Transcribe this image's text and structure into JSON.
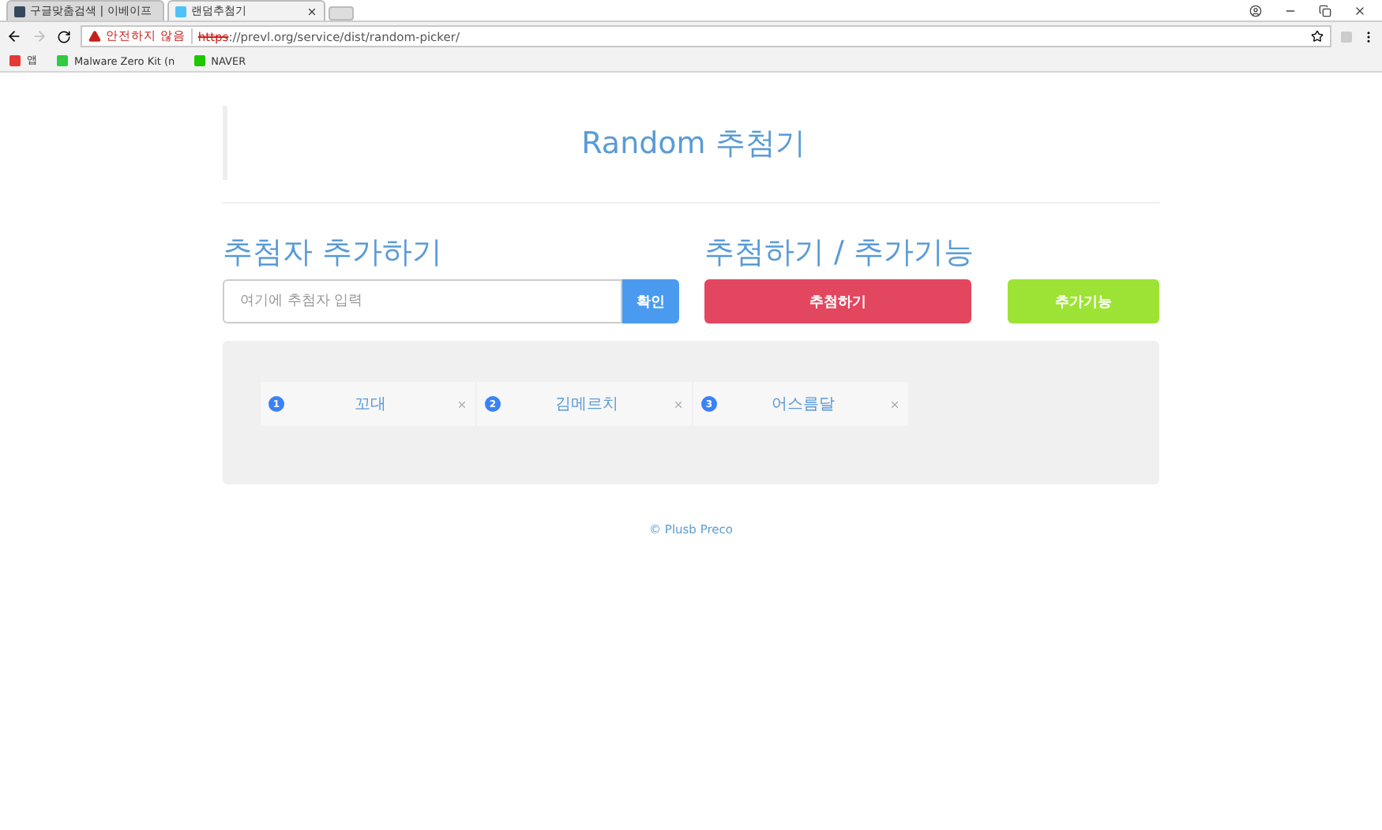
{
  "browser": {
    "tabs": [
      {
        "title": "구글맞춤검색 | 이베이프",
        "selected": false
      },
      {
        "title": "랜덤추첨기",
        "selected": true
      }
    ],
    "security": "안전하지 않음",
    "url_scheme": "https",
    "url_rest": "://prevl.org/service/dist/random-picker/",
    "bookmarks": [
      {
        "label": "앱",
        "kind": "apps"
      },
      {
        "label": "Malware Zero Kit (n",
        "kind": "green"
      },
      {
        "label": "NAVER",
        "kind": "naver"
      }
    ]
  },
  "page": {
    "title": "Random 추첨기",
    "add_heading": "추첨자 추가하기",
    "draw_heading": "추첨하기 / 추가기능",
    "input": {
      "placeholder": "여기에 추첨자 입력"
    },
    "confirm_button": "확인",
    "draw_button": "추첨하기",
    "extra_button": "추가기능",
    "entries": [
      {
        "number": "1",
        "name": "꼬대"
      },
      {
        "number": "2",
        "name": "김메르치"
      },
      {
        "number": "3",
        "name": "어스름달"
      }
    ],
    "footer": "© Plusb Preco"
  }
}
